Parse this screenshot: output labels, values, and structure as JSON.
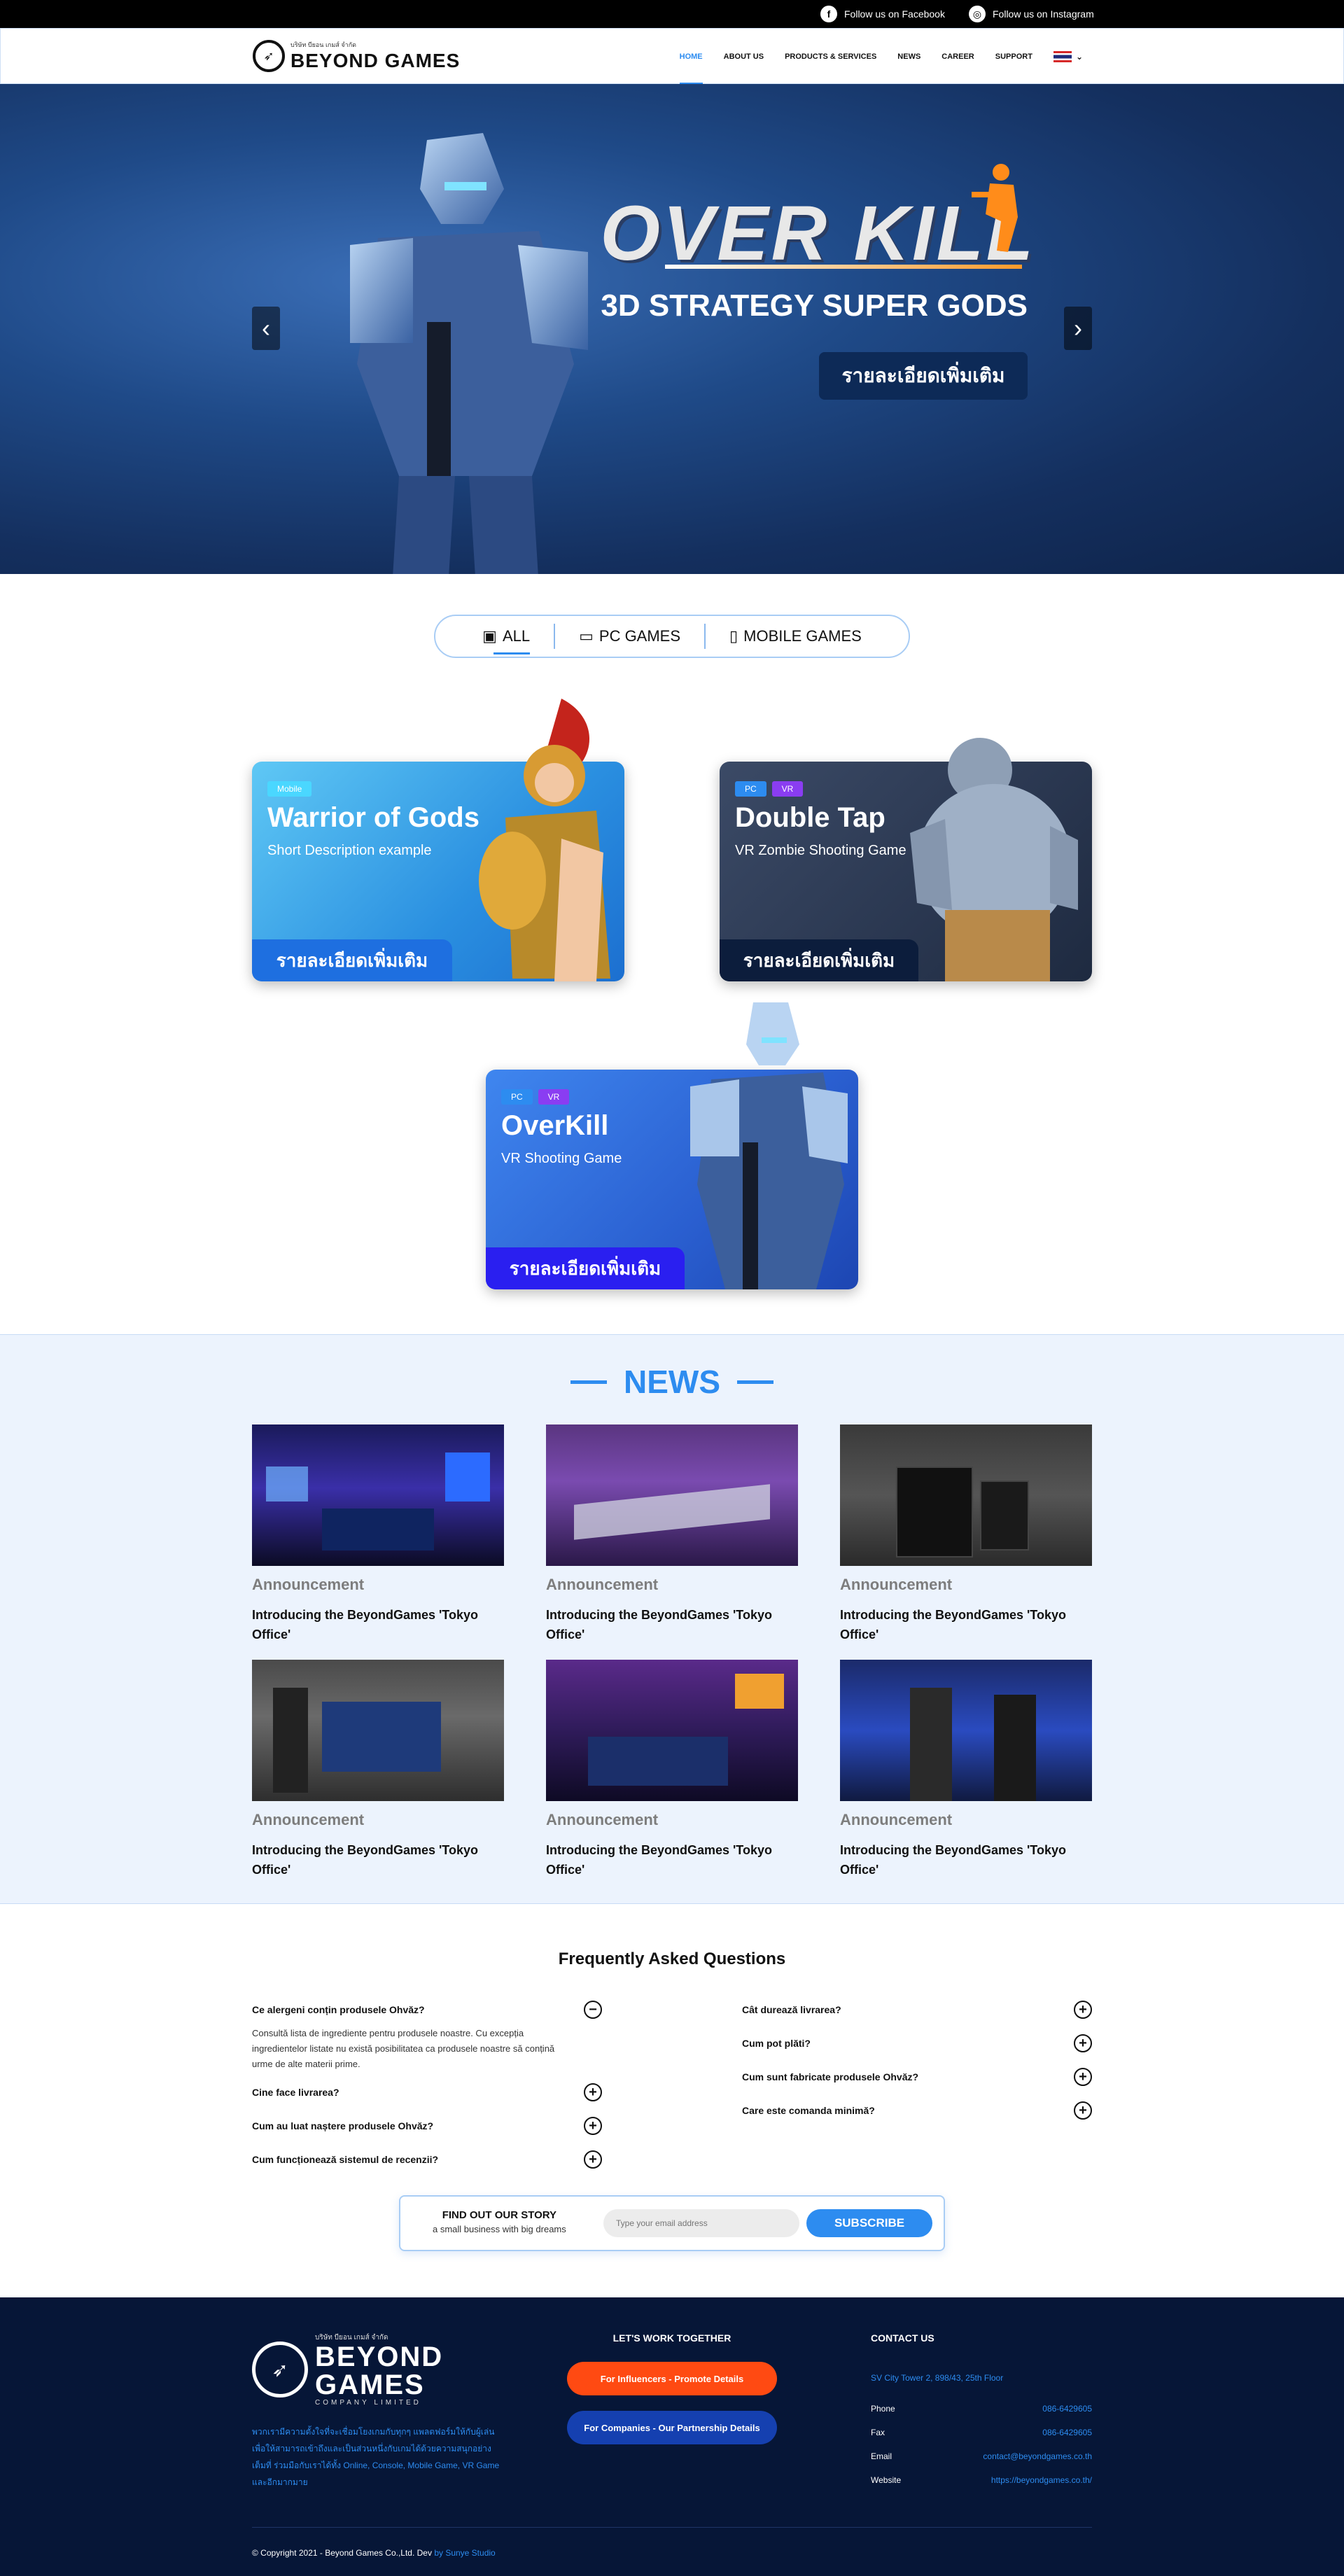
{
  "topbar": {
    "facebook": "Follow us on Facebook",
    "instagram": "Follow us on Instagram"
  },
  "nav": {
    "logo_small": "บริษัท บียอน เกมส์ จำกัด",
    "logo_text": "BEYOND GAMES",
    "items": [
      "HOME",
      "ABOUT US",
      "PRODUCTS & SERVICES",
      "NEWS",
      "CAREER",
      "SUPPORT"
    ],
    "active": "HOME"
  },
  "hero": {
    "title": "OVER KILL",
    "subtitle": "3D STRATEGY SUPER GODS",
    "button": "รายละเอียดเพิ่มเติม"
  },
  "filter": {
    "tabs": [
      "ALL",
      "PC GAMES",
      "MOBILE GAMES"
    ],
    "active": "ALL"
  },
  "games": [
    {
      "tags": [
        "Mobile"
      ],
      "title": "Warrior of Gods",
      "desc": "Short Description example",
      "button": "รายละเอียดเพิ่มเติม"
    },
    {
      "tags": [
        "PC",
        "VR"
      ],
      "title": "Double Tap",
      "desc": "VR Zombie Shooting Game",
      "button": "รายละเอียดเพิ่มเติม"
    },
    {
      "tags": [
        "PC",
        "VR"
      ],
      "title": "OverKill",
      "desc": "VR Shooting Game",
      "button": "รายละเอียดเพิ่มเติม"
    }
  ],
  "news": {
    "heading": "NEWS",
    "items": [
      {
        "category": "Announcement",
        "title": "Introducing the BeyondGames 'Tokyo Office'"
      },
      {
        "category": "Announcement",
        "title": "Introducing the BeyondGames 'Tokyo Office'"
      },
      {
        "category": "Announcement",
        "title": "Introducing the BeyondGames 'Tokyo Office'"
      },
      {
        "category": "Announcement",
        "title": "Introducing the BeyondGames 'Tokyo Office'"
      },
      {
        "category": "Announcement",
        "title": "Introducing the BeyondGames 'Tokyo Office'"
      },
      {
        "category": "Announcement",
        "title": "Introducing the BeyondGames 'Tokyo Office'"
      }
    ]
  },
  "faq": {
    "title": "Frequently Asked Questions",
    "left": [
      {
        "q": "Ce alergeni conțin produsele Ohvăz?",
        "open": true,
        "a": "Consultă lista de ingrediente pentru produsele noastre. Cu excepția ingredientelor listate nu există posibilitatea ca produsele noastre să conțină urme de alte materii prime."
      },
      {
        "q": "Cine face livrarea?",
        "open": false
      },
      {
        "q": "Cum au luat naștere produsele Ohvăz?",
        "open": false
      },
      {
        "q": "Cum funcționează sistemul de recenzii?",
        "open": false
      }
    ],
    "right": [
      {
        "q": "Cât durează livrarea?",
        "open": false
      },
      {
        "q": "Cum pot plăti?",
        "open": false
      },
      {
        "q": "Cum sunt fabricate produsele Ohvăz?",
        "open": false
      },
      {
        "q": "Care este comanda minimă?",
        "open": false
      }
    ]
  },
  "subscribe": {
    "heading": "FIND OUT OUR STORY",
    "sub": "a small business with big dreams",
    "placeholder": "Type your email address",
    "button": "SUBSCRIBE"
  },
  "footer": {
    "logo_small": "บริษัท บียอน เกมส์ จำกัด",
    "logo_line1": "BEYOND",
    "logo_line2": "GAMES",
    "logo_company": "COMPANY LIMITED",
    "about": "พวกเรามีความตั้งใจที่จะเชื่อมโยงเกมกับทุกๆ แพลตฟอร์มให้กับผู้เล่นเพื่อให้สามารถเข้าถึงและเป็นส่วนหนึ่งกับเกมได้ด้วยความสนุกอย่างเต็มที่ ร่วมมือกับเราได้ทั้ง Online, Console, Mobile Game, VR Game และอีกมากมาย",
    "work_heading": "LET'S WORK TOGETHER",
    "btn_influencers": "For Influencers - Promote Details",
    "btn_companies": "For Companies - Our Partnership Details",
    "contact_heading": "CONTACT US",
    "address": "SV City Tower 2, 898/43, 25th Floor",
    "contacts": [
      {
        "label": "Phone",
        "value": "086-6429605"
      },
      {
        "label": "Fax",
        "value": "086-6429605"
      },
      {
        "label": "Email",
        "value": "contact@beyondgames.co.th"
      },
      {
        "label": "Website",
        "value": "https://beyondgames.co.th/"
      }
    ],
    "copyright": "© Copyright 2021 - Beyond Games Co.,Ltd. Dev",
    "dev": "by Sunye Studio"
  },
  "colors": {
    "accent": "#2d8cf0",
    "footer_bg": "#061637",
    "news_bg": "#ecf3fd",
    "orange": "#ff4a12",
    "partner": "#1540b0"
  }
}
